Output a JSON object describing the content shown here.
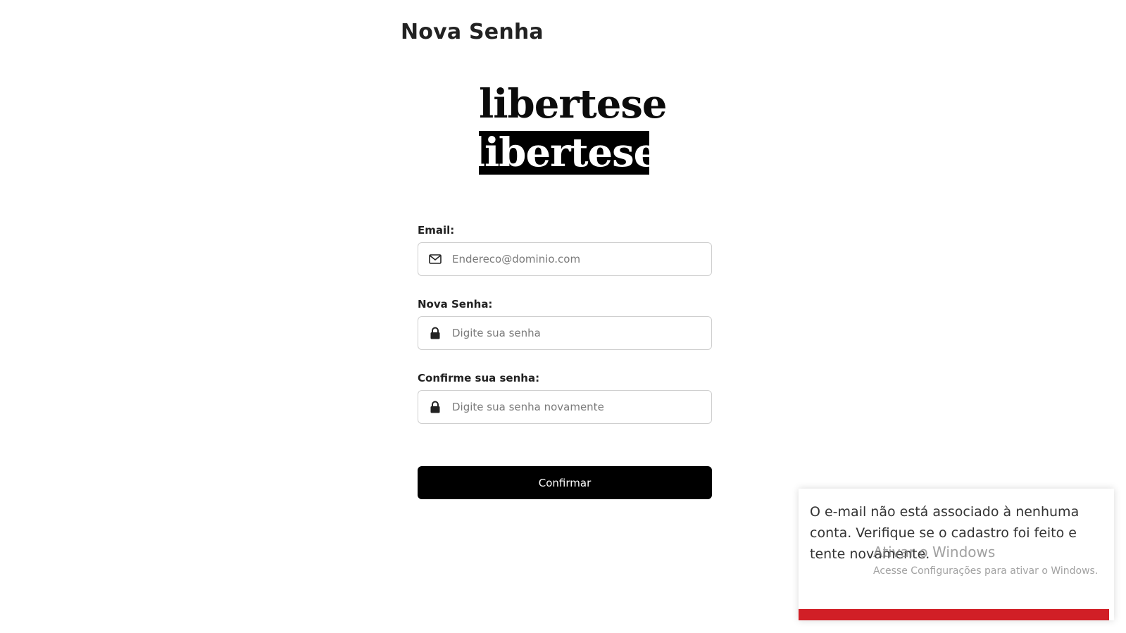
{
  "page": {
    "title": "Nova Senha"
  },
  "logo": {
    "line1": "libertese",
    "line2": "libertese"
  },
  "form": {
    "email": {
      "label": "Email:",
      "placeholder": "Endereco@dominio.com",
      "icon": "envelope-icon"
    },
    "new_password": {
      "label": "Nova Senha:",
      "placeholder": "Digite sua senha",
      "icon": "lock-icon"
    },
    "confirm_password": {
      "label": "Confirme sua senha:",
      "placeholder": "Digite sua senha novamente",
      "icon": "lock-icon"
    },
    "submit_label": "Confirmar"
  },
  "toast": {
    "message": "O e-mail não está associado à nenhuma conta. Verifique se o cadastro foi feito e tente novamente.",
    "progress": 0.985,
    "progress_color": "#d11f26"
  },
  "watermark": {
    "title": "Ativar o Windows",
    "subtitle": "Acesse Configurações para ativar o Windows."
  },
  "colors": {
    "button_bg": "#000000",
    "button_text": "#ffffff",
    "input_border": "#cfcfcf"
  }
}
